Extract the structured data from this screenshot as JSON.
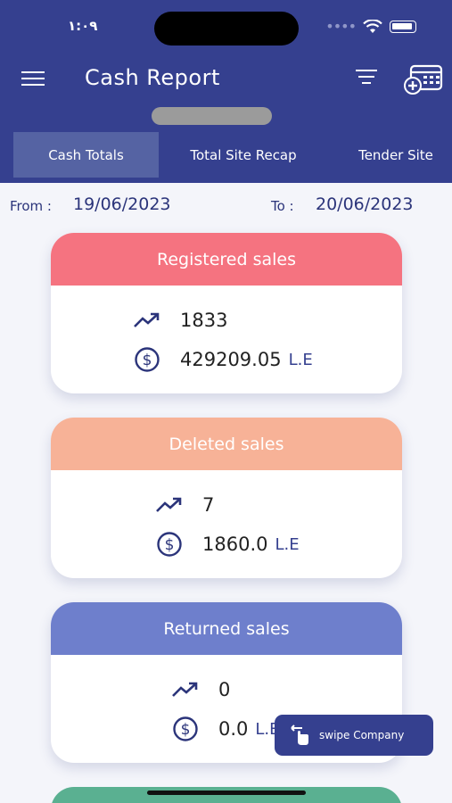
{
  "status_bar": {
    "time": "١:٠٩",
    "signal_icon": "signal-dots-icon",
    "wifi_icon": "wifi-icon",
    "battery_icon": "battery-icon"
  },
  "header": {
    "title": "Cash Report",
    "menu_icon": "hamburger-menu-icon",
    "filter_icon": "filter-icon",
    "calendar_icon": "calendar-add-icon"
  },
  "tabs": [
    {
      "label": "Cash Totals",
      "active": true
    },
    {
      "label": "Total Site Recap",
      "active": false
    },
    {
      "label": "Tender Site",
      "active": false
    }
  ],
  "dates": {
    "from_label": "From :",
    "from_value": "19/06/2023",
    "to_label": "To :",
    "to_value": "20/06/2023"
  },
  "cards": [
    {
      "title": "Registered sales",
      "count": "1833",
      "amount": "429209.05",
      "currency": "L.E",
      "color": "#f57380"
    },
    {
      "title": "Deleted sales",
      "count": "7",
      "amount": "1860.0",
      "currency": "L.E",
      "color": "#f7b297"
    },
    {
      "title": "Returned sales",
      "count": "0",
      "amount": "0.0",
      "currency": "L.E",
      "color": "#6e7fcc"
    }
  ],
  "swipe_button": {
    "label": "swipe Company",
    "icon": "swipe-hand-icon"
  },
  "colors": {
    "primary": "#35408f",
    "background": "#f4f5fa",
    "peek_card": "#5ab091"
  }
}
